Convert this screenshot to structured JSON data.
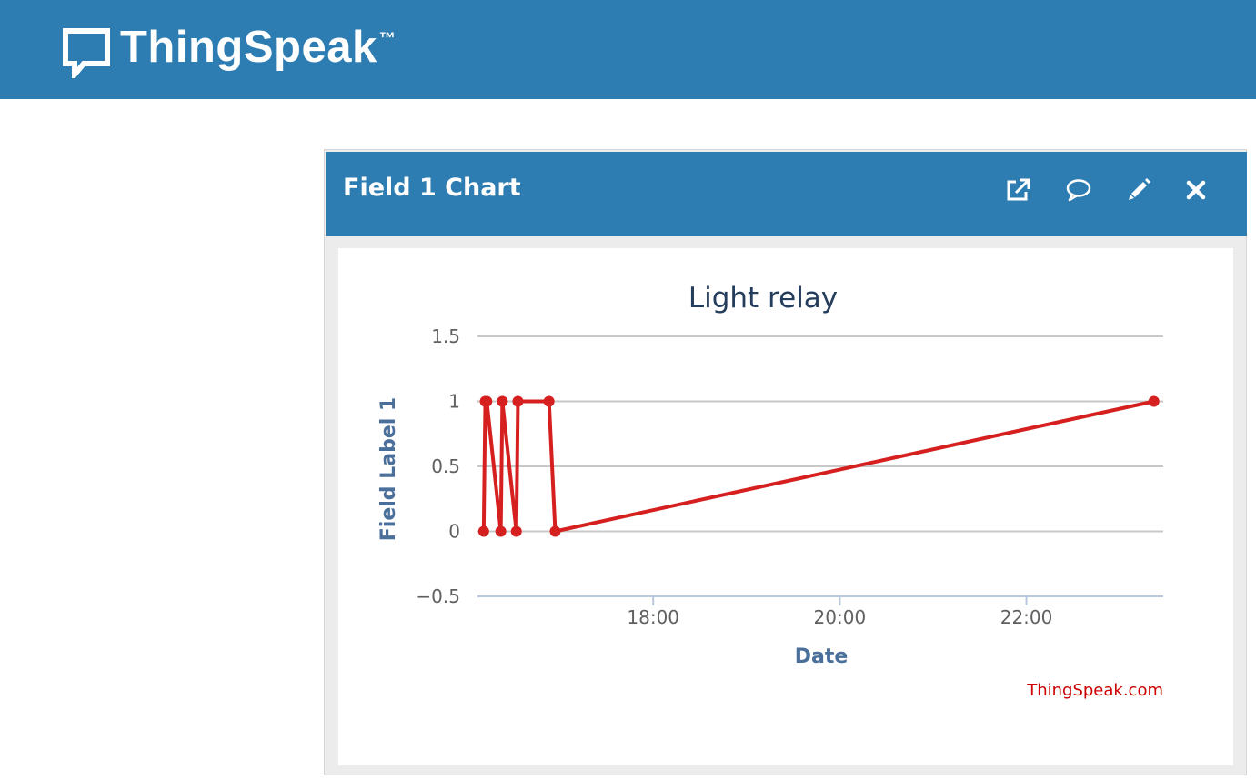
{
  "brand": {
    "name": "ThingSpeak",
    "trademark": "™"
  },
  "panel": {
    "title": "Field 1 Chart",
    "actions": {
      "popout": "popout-icon",
      "comment": "comment-icon",
      "edit": "pencil-icon",
      "close": "close-icon"
    }
  },
  "colors": {
    "header_blue": "#2d7db3",
    "series_red": "#d62020",
    "axis_label_blue": "#4a6f9b",
    "title_navy": "#243d5c",
    "credit_red": "#cc0000"
  },
  "chart_data": {
    "type": "line",
    "title": "Light relay",
    "xlabel": "Date",
    "ylabel": "Field Label 1",
    "credit": "ThingSpeak.com",
    "xlim": [
      "16:07",
      "23:28"
    ],
    "ylim": [
      -0.5,
      1.5
    ],
    "yticks": [
      "−0.5",
      "0",
      "0.5",
      "1",
      "1.5"
    ],
    "ytick_values": [
      -0.5,
      0,
      0.5,
      1,
      1.5
    ],
    "xticks": [
      "18:00",
      "20:00",
      "22:00"
    ],
    "xtick_values": [
      "18:00",
      "20:00",
      "22:00"
    ],
    "grid": true,
    "legend": "none",
    "series": [
      {
        "x": [
          "16:11",
          "16:12",
          "16:13",
          "16:22",
          "16:23",
          "16:32",
          "16:33",
          "16:53",
          "16:57",
          "23:22"
        ],
        "y": [
          0,
          1,
          1,
          0,
          1,
          0,
          1,
          1,
          0,
          1
        ]
      }
    ]
  }
}
